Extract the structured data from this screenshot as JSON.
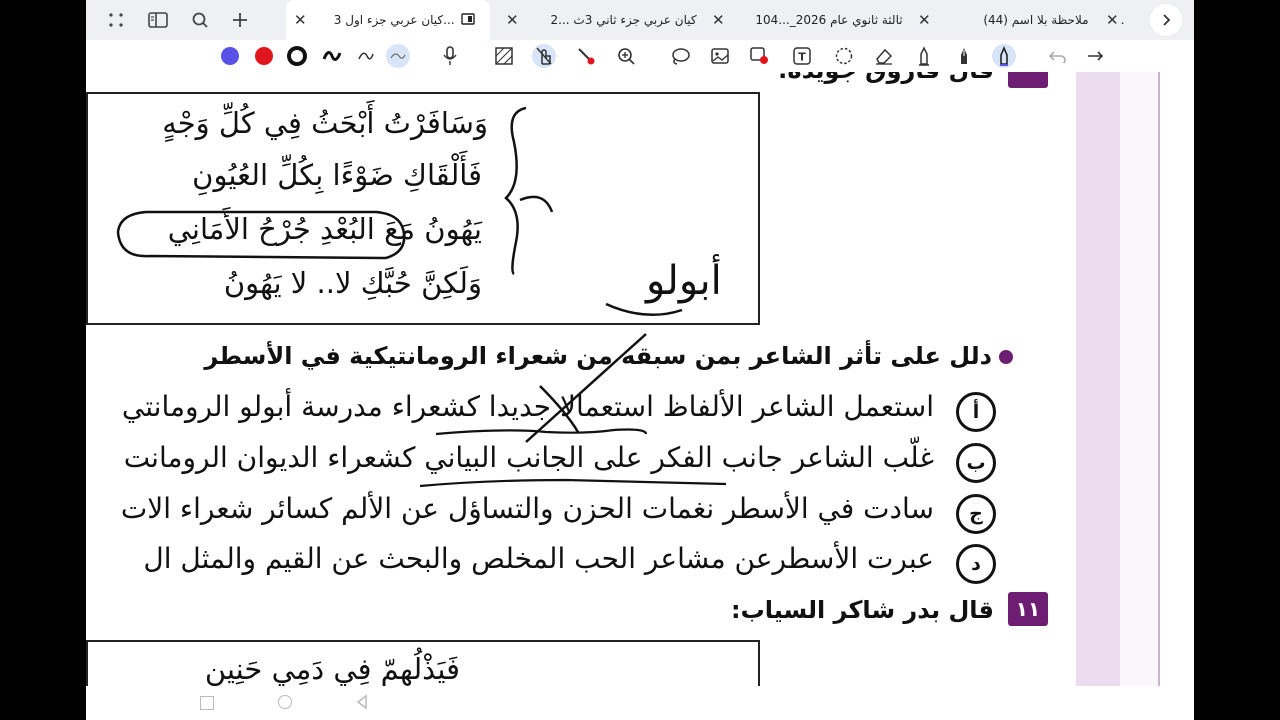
{
  "tabs": [
    {
      "label": "كيان عربي جزء اول 3...",
      "active": true
    },
    {
      "label": "كيان عربي جزء ثاني 3ث ...2",
      "active": false
    },
    {
      "label": "ثالثة ثانوي عام 2026_...104",
      "active": false
    },
    {
      "label": "ملاحظة بلا اسم (44)",
      "active": false
    },
    {
      "label": ".",
      "active": false
    }
  ],
  "toolbar": {
    "colors": {
      "pen_blue": "#5a52e6",
      "pen_red": "#e0161e",
      "pen_black": "#111111",
      "accent": "#6d1e72"
    }
  },
  "document": {
    "prev_heading": "قال فاروق جويدة:",
    "verses": [
      "وَسَافَرْتُ أَبْحَثُ فِي كُلِّ وَجْهٍ",
      "فَأَلْقَاكِ ضَوْءًا بِكُلِّ العُيُونِ",
      "يَهُونُ مَعَ البُعْدِ جُرْحُ الأَمَانِي",
      "وَلَكِنَّ حُبَّكِ لا.. لا يَهُونُ"
    ],
    "handwritten_note": "أبولو",
    "question": "دلل على تأثر الشاعر بمن سبقه من شعراء الرومانتيكية في الأسطر",
    "options": [
      {
        "letter": "أ",
        "text": "استعمل الشاعر الألفاظ استعمالا جديدا كشعراء مدرسة أبولو الرومانتي"
      },
      {
        "letter": "ب",
        "text": "غلّب الشاعر جانب الفكر على الجانب البياني كشعراء الديوان الرومانت"
      },
      {
        "letter": "ج",
        "text": "سادت في الأسطر نغمات الحزن والتساؤل عن الألم كسائر شعراء الات"
      },
      {
        "letter": "د",
        "text": "عبرت الأسطرعن مشاعر الحب المخلص والبحث عن القيم والمثل ال"
      }
    ],
    "next_question_number": "١١",
    "next_heading": "قال بدر شاكر السياب:",
    "next_verse_partial": "فَيَذْلُهمّ فِي دَمِي حَنِين"
  }
}
